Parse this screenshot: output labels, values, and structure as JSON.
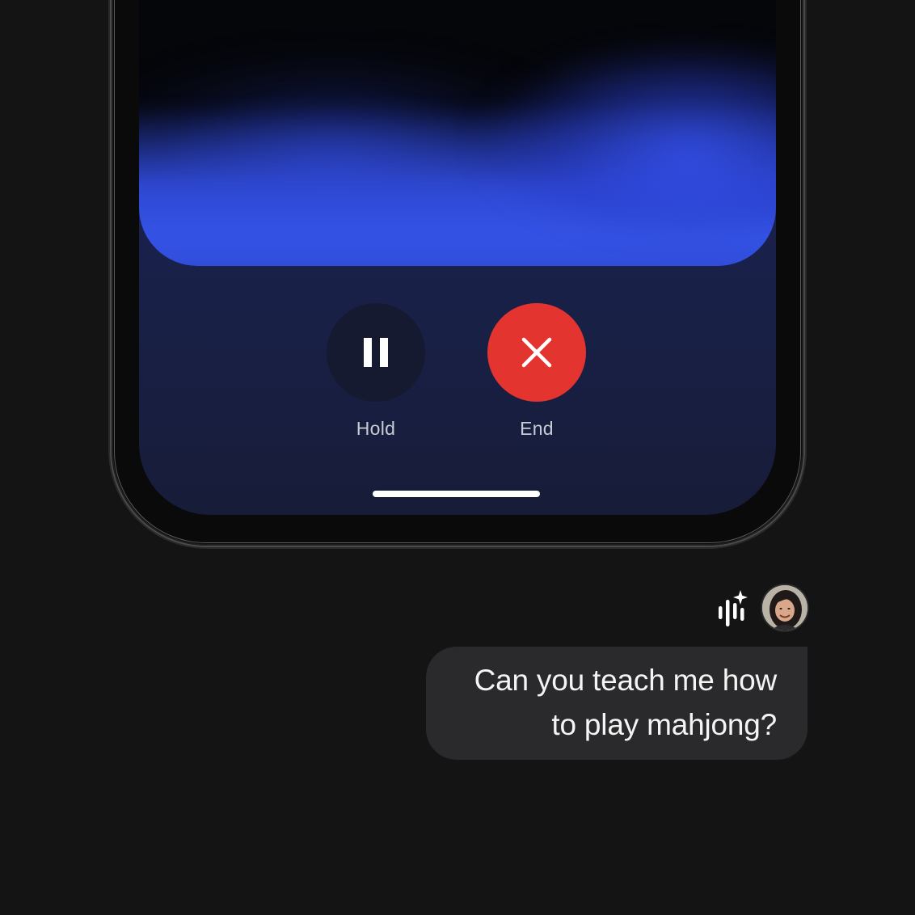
{
  "call": {
    "hold_label": "Hold",
    "end_label": "End",
    "hold_icon": "pause-icon",
    "end_icon": "close-icon"
  },
  "colors": {
    "background": "#141414",
    "screen": "#19214a",
    "glow": "#3453e6",
    "end_button": "#e3342f",
    "hold_button": "#151a30",
    "bubble": "#2a2a2c"
  },
  "chat": {
    "assistant_icon": "sparkle-waveform-icon",
    "avatar_icon": "user-avatar",
    "message_line1": "Can you teach me how",
    "message_line2": "to play mahjong?"
  }
}
